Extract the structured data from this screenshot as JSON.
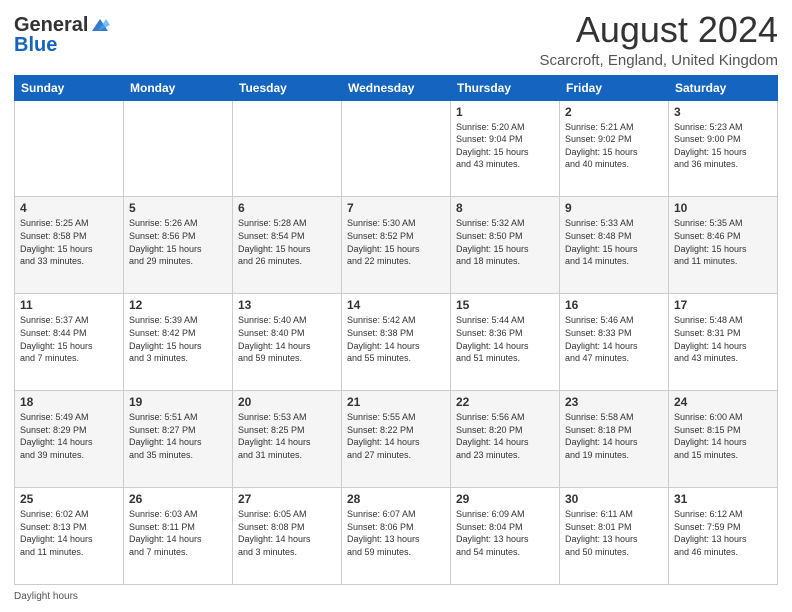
{
  "header": {
    "logo_general": "General",
    "logo_blue": "Blue",
    "month_title": "August 2024",
    "location": "Scarcroft, England, United Kingdom"
  },
  "days_of_week": [
    "Sunday",
    "Monday",
    "Tuesday",
    "Wednesday",
    "Thursday",
    "Friday",
    "Saturday"
  ],
  "weeks": [
    [
      {
        "day": "",
        "info": ""
      },
      {
        "day": "",
        "info": ""
      },
      {
        "day": "",
        "info": ""
      },
      {
        "day": "",
        "info": ""
      },
      {
        "day": "1",
        "info": "Sunrise: 5:20 AM\nSunset: 9:04 PM\nDaylight: 15 hours\nand 43 minutes."
      },
      {
        "day": "2",
        "info": "Sunrise: 5:21 AM\nSunset: 9:02 PM\nDaylight: 15 hours\nand 40 minutes."
      },
      {
        "day": "3",
        "info": "Sunrise: 5:23 AM\nSunset: 9:00 PM\nDaylight: 15 hours\nand 36 minutes."
      }
    ],
    [
      {
        "day": "4",
        "info": "Sunrise: 5:25 AM\nSunset: 8:58 PM\nDaylight: 15 hours\nand 33 minutes."
      },
      {
        "day": "5",
        "info": "Sunrise: 5:26 AM\nSunset: 8:56 PM\nDaylight: 15 hours\nand 29 minutes."
      },
      {
        "day": "6",
        "info": "Sunrise: 5:28 AM\nSunset: 8:54 PM\nDaylight: 15 hours\nand 26 minutes."
      },
      {
        "day": "7",
        "info": "Sunrise: 5:30 AM\nSunset: 8:52 PM\nDaylight: 15 hours\nand 22 minutes."
      },
      {
        "day": "8",
        "info": "Sunrise: 5:32 AM\nSunset: 8:50 PM\nDaylight: 15 hours\nand 18 minutes."
      },
      {
        "day": "9",
        "info": "Sunrise: 5:33 AM\nSunset: 8:48 PM\nDaylight: 15 hours\nand 14 minutes."
      },
      {
        "day": "10",
        "info": "Sunrise: 5:35 AM\nSunset: 8:46 PM\nDaylight: 15 hours\nand 11 minutes."
      }
    ],
    [
      {
        "day": "11",
        "info": "Sunrise: 5:37 AM\nSunset: 8:44 PM\nDaylight: 15 hours\nand 7 minutes."
      },
      {
        "day": "12",
        "info": "Sunrise: 5:39 AM\nSunset: 8:42 PM\nDaylight: 15 hours\nand 3 minutes."
      },
      {
        "day": "13",
        "info": "Sunrise: 5:40 AM\nSunset: 8:40 PM\nDaylight: 14 hours\nand 59 minutes."
      },
      {
        "day": "14",
        "info": "Sunrise: 5:42 AM\nSunset: 8:38 PM\nDaylight: 14 hours\nand 55 minutes."
      },
      {
        "day": "15",
        "info": "Sunrise: 5:44 AM\nSunset: 8:36 PM\nDaylight: 14 hours\nand 51 minutes."
      },
      {
        "day": "16",
        "info": "Sunrise: 5:46 AM\nSunset: 8:33 PM\nDaylight: 14 hours\nand 47 minutes."
      },
      {
        "day": "17",
        "info": "Sunrise: 5:48 AM\nSunset: 8:31 PM\nDaylight: 14 hours\nand 43 minutes."
      }
    ],
    [
      {
        "day": "18",
        "info": "Sunrise: 5:49 AM\nSunset: 8:29 PM\nDaylight: 14 hours\nand 39 minutes."
      },
      {
        "day": "19",
        "info": "Sunrise: 5:51 AM\nSunset: 8:27 PM\nDaylight: 14 hours\nand 35 minutes."
      },
      {
        "day": "20",
        "info": "Sunrise: 5:53 AM\nSunset: 8:25 PM\nDaylight: 14 hours\nand 31 minutes."
      },
      {
        "day": "21",
        "info": "Sunrise: 5:55 AM\nSunset: 8:22 PM\nDaylight: 14 hours\nand 27 minutes."
      },
      {
        "day": "22",
        "info": "Sunrise: 5:56 AM\nSunset: 8:20 PM\nDaylight: 14 hours\nand 23 minutes."
      },
      {
        "day": "23",
        "info": "Sunrise: 5:58 AM\nSunset: 8:18 PM\nDaylight: 14 hours\nand 19 minutes."
      },
      {
        "day": "24",
        "info": "Sunrise: 6:00 AM\nSunset: 8:15 PM\nDaylight: 14 hours\nand 15 minutes."
      }
    ],
    [
      {
        "day": "25",
        "info": "Sunrise: 6:02 AM\nSunset: 8:13 PM\nDaylight: 14 hours\nand 11 minutes."
      },
      {
        "day": "26",
        "info": "Sunrise: 6:03 AM\nSunset: 8:11 PM\nDaylight: 14 hours\nand 7 minutes."
      },
      {
        "day": "27",
        "info": "Sunrise: 6:05 AM\nSunset: 8:08 PM\nDaylight: 14 hours\nand 3 minutes."
      },
      {
        "day": "28",
        "info": "Sunrise: 6:07 AM\nSunset: 8:06 PM\nDaylight: 13 hours\nand 59 minutes."
      },
      {
        "day": "29",
        "info": "Sunrise: 6:09 AM\nSunset: 8:04 PM\nDaylight: 13 hours\nand 54 minutes."
      },
      {
        "day": "30",
        "info": "Sunrise: 6:11 AM\nSunset: 8:01 PM\nDaylight: 13 hours\nand 50 minutes."
      },
      {
        "day": "31",
        "info": "Sunrise: 6:12 AM\nSunset: 7:59 PM\nDaylight: 13 hours\nand 46 minutes."
      }
    ]
  ],
  "footer": {
    "daylight_hours": "Daylight hours"
  }
}
